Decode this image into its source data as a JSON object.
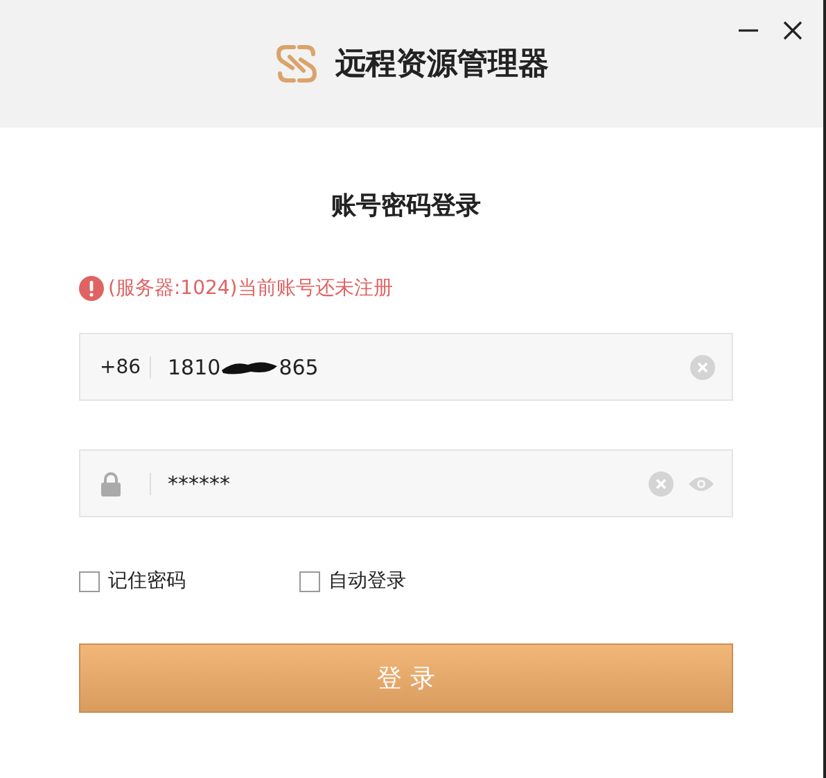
{
  "window": {
    "title": "远程资源管理器"
  },
  "form": {
    "heading": "账号密码登录",
    "error": "(服务器:1024)当前账号还未注册",
    "phone": {
      "country_code": "+86",
      "value_start": "1810",
      "value_end": "865"
    },
    "password": {
      "value": "******"
    },
    "options": [
      {
        "label": "记住密码",
        "checked": false
      },
      {
        "label": "自动登录",
        "checked": false
      }
    ],
    "submit": "登 录"
  }
}
